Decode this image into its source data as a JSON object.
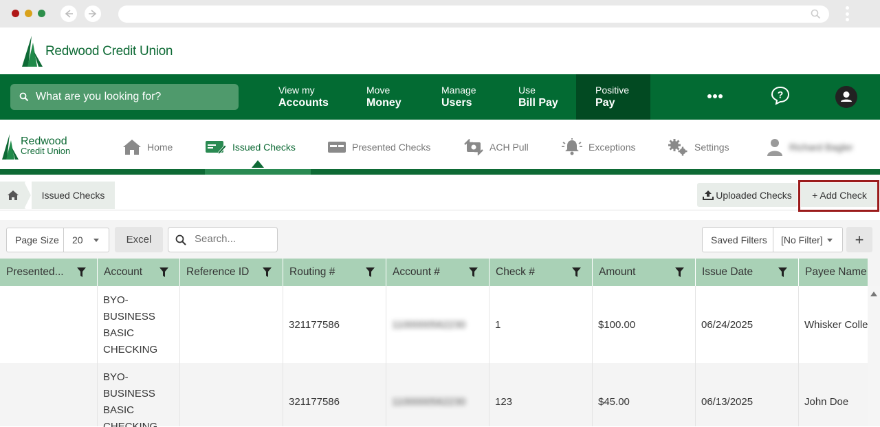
{
  "browser": {
    "traffic_colors": [
      "#b01818",
      "#d9a21b",
      "#2d8f4b"
    ]
  },
  "bank": {
    "name": "Redwood Credit Union",
    "search_placeholder": "What are you looking for?",
    "menu": [
      {
        "line1": "View my",
        "line2": "Accounts"
      },
      {
        "line1": "Move",
        "line2": "Money"
      },
      {
        "line1": "Manage",
        "line2": "Users"
      },
      {
        "line1": "Use",
        "line2": "Bill Pay"
      },
      {
        "line1": "Positive",
        "line2": "Pay",
        "active": true
      }
    ],
    "more_icon": "ellipsis-icon",
    "help_icon": "help-chat-icon",
    "profile_icon": "user-avatar-icon"
  },
  "app": {
    "brand_line1": "Redwood",
    "brand_line2": "Credit Union",
    "nav": [
      {
        "label": "Home",
        "icon": "home-icon"
      },
      {
        "label": "Issued Checks",
        "icon": "check-edit-icon",
        "active": true
      },
      {
        "label": "Presented Checks",
        "icon": "check-card-icon"
      },
      {
        "label": "ACH Pull",
        "icon": "ach-transfer-icon"
      },
      {
        "label": "Exceptions",
        "icon": "alert-bell-icon"
      },
      {
        "label": "Settings",
        "icon": "gears-icon"
      },
      {
        "label": "Richard Bagler",
        "icon": "user-icon"
      }
    ]
  },
  "breadcrumb": {
    "current": "Issued Checks"
  },
  "actions": {
    "uploaded": "Uploaded Checks",
    "add": "+ Add Check"
  },
  "toolbar": {
    "page_size_label": "Page Size",
    "page_size_value": "20",
    "excel": "Excel",
    "search_placeholder": "Search...",
    "saved_filters_label": "Saved Filters",
    "saved_filters_value": "[No Filter]",
    "add_filter": "+"
  },
  "table": {
    "columns": [
      "Presented...",
      "Account",
      "Reference ID",
      "Routing #",
      "Account #",
      "Check #",
      "Amount",
      "Issue Date",
      "Payee Name"
    ],
    "rows": [
      {
        "presented": "",
        "account_lines": [
          "BYO-",
          "BUSINESS",
          "BASIC",
          "CHECKING"
        ],
        "reference": "",
        "routing": "321177586",
        "account_no": "1100000562230",
        "check_no": "1",
        "amount": "$100.00",
        "issue_date": "06/24/2025",
        "payee": "Whisker Colle"
      },
      {
        "presented": "",
        "account_lines": [
          "BYO-",
          "BUSINESS",
          "BASIC",
          "CHECKING"
        ],
        "reference": "",
        "routing": "321177586",
        "account_no": "1100000562230",
        "check_no": "123",
        "amount": "$45.00",
        "issue_date": "06/13/2025",
        "payee": "John Doe"
      }
    ]
  },
  "colors": {
    "brand_green": "#036b33",
    "header_green": "#a9d1b6",
    "highlight_outline": "#9b1b1b"
  }
}
